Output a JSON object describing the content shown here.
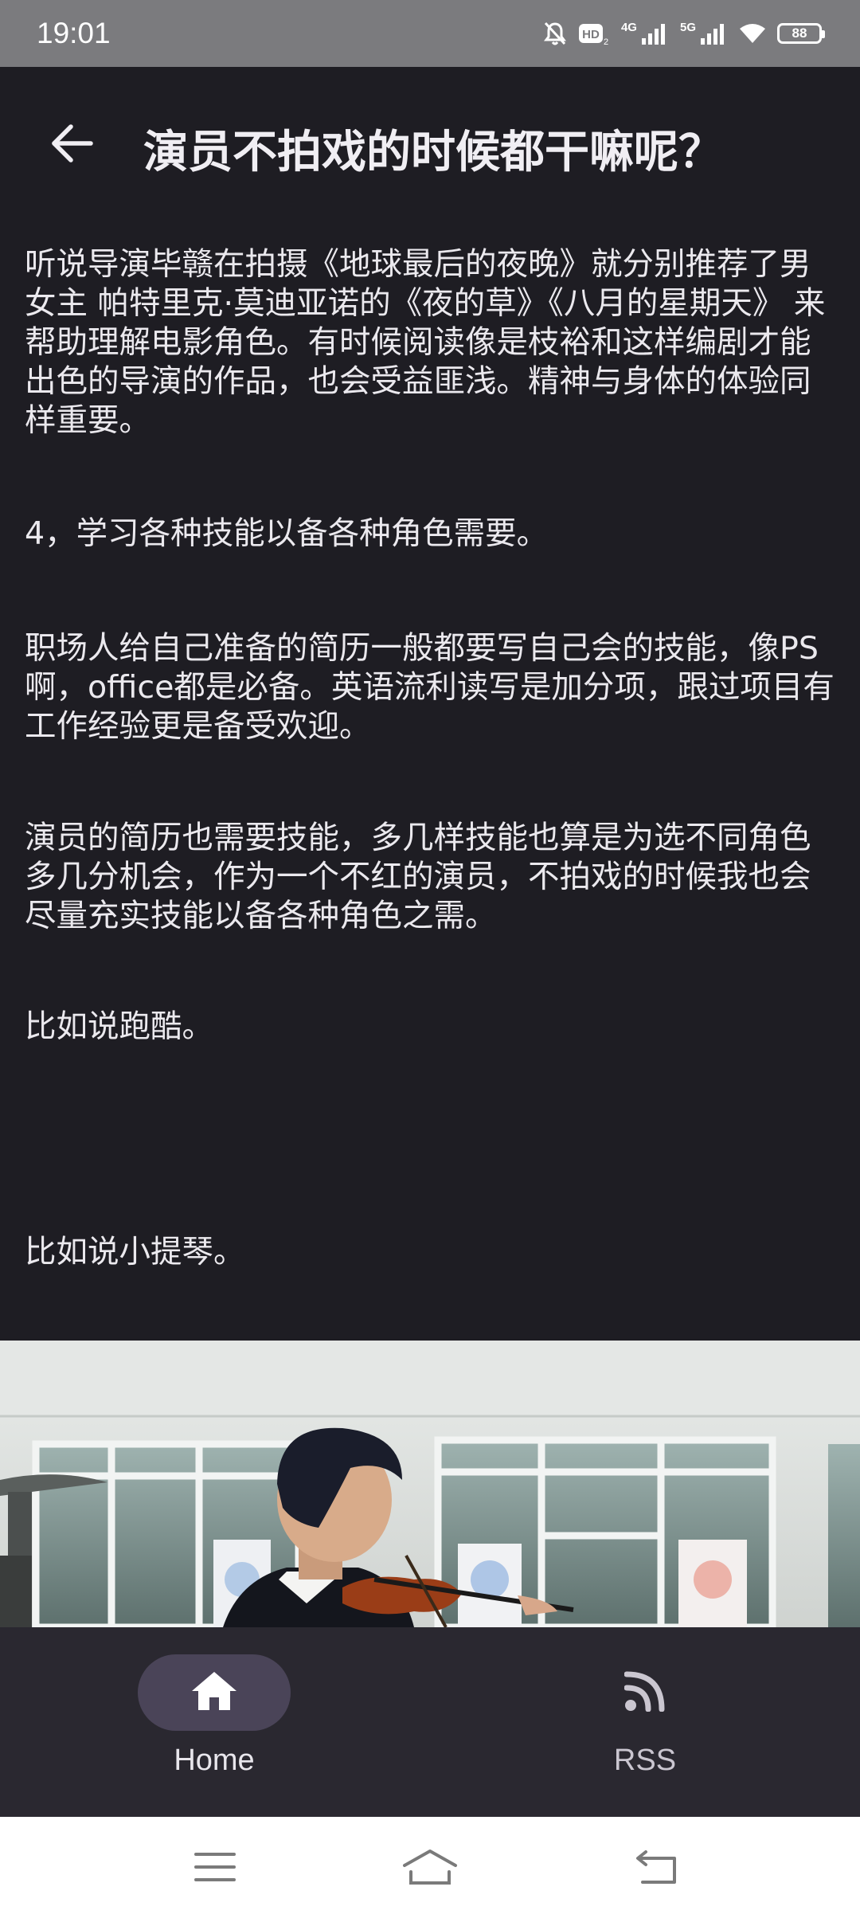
{
  "status_bar": {
    "time": "19:01",
    "network_1": "4G",
    "network_2": "5G",
    "battery": "88",
    "icons": [
      "mute-icon",
      "hd-icon",
      "signal-icon",
      "signal-icon",
      "wifi-icon",
      "battery-icon"
    ]
  },
  "header": {
    "title": "演员不拍戏的时候都干嘛呢？",
    "back_icon": "arrow-left-icon"
  },
  "article": {
    "paragraphs": [
      "听说导演毕赣在拍摄《地球最后的夜晚》就分别推荐了男女主 帕特里克·莫迪亚诺的《夜的草》《八月的星期天》 来帮助理解电影角色。有时候阅读像是枝裕和这样编剧才能出色的导演的作品，也会受益匪浅。精神与身体的体验同样重要。",
      "4，学习各种技能以备各种角色需要。",
      "职场人给自己准备的简历一般都要写自己会的技能，像PS啊，office都是必备。英语流利读写是加分项，跟过项目有工作经验更是备受欢迎。",
      "演员的简历也需要技能，多几样技能也算是为选不同角色多几分机会，作为一个不红的演员，不拍戏的时候我也会尽量充实技能以备各种角色之需。",
      "比如说跑酷。",
      "比如说小提琴。"
    ]
  },
  "bottom_nav": {
    "items": [
      {
        "label": "Home",
        "icon": "home-icon",
        "selected": true
      },
      {
        "label": "RSS",
        "icon": "rss-icon",
        "selected": false
      }
    ]
  },
  "colors": {
    "background": "#1e1d23",
    "status_bar": "#7b7b7e",
    "nav_bar": "#2a2830",
    "nav_pill": "#4a4458"
  }
}
